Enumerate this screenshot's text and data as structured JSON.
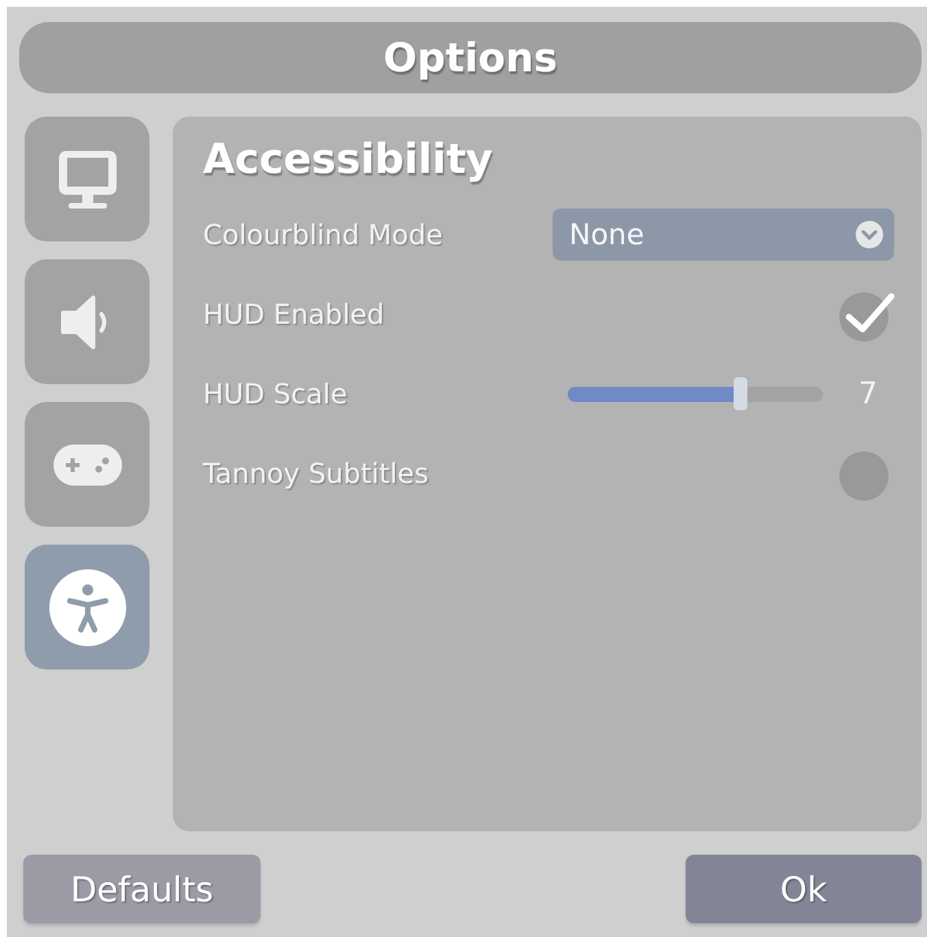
{
  "window": {
    "title": "Options"
  },
  "sidebar": {
    "items": [
      {
        "kind": "display",
        "selected": false
      },
      {
        "kind": "sound",
        "selected": false
      },
      {
        "kind": "gamepad",
        "selected": false
      },
      {
        "kind": "accessibility",
        "selected": true
      }
    ]
  },
  "panel": {
    "heading": "Accessibility",
    "settings": [
      {
        "kind": "dropdown",
        "label": "Colourblind Mode",
        "value": "None"
      },
      {
        "kind": "checkbox",
        "label": "HUD Enabled",
        "checked": true
      },
      {
        "kind": "slider",
        "label": "HUD Scale",
        "level": 0.68,
        "reading": "7"
      },
      {
        "kind": "checkbox",
        "label": "Tannoy Subtitles",
        "checked": false
      }
    ]
  },
  "buttons": [
    {
      "label": "Defaults",
      "kind": "secondary"
    },
    {
      "label": "Ok",
      "kind": "primary"
    }
  ]
}
